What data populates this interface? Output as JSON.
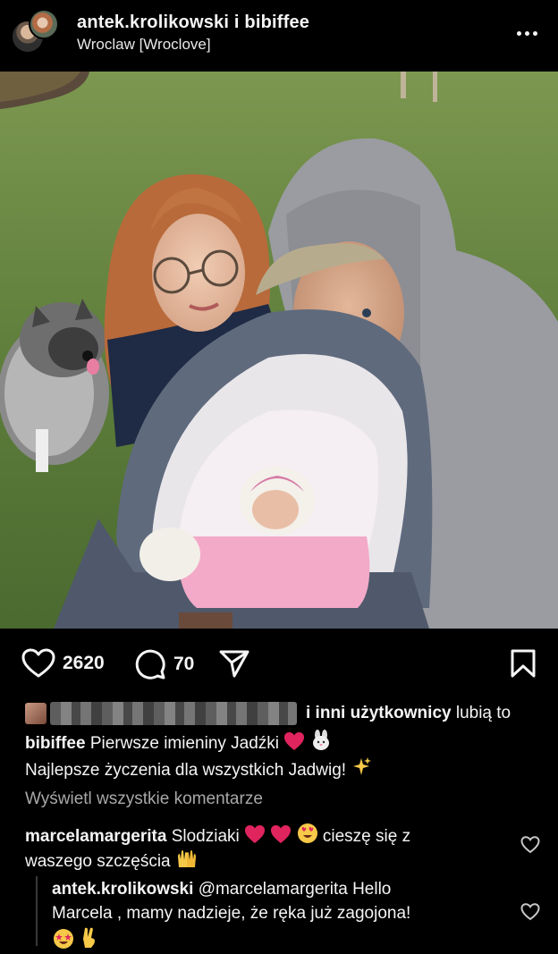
{
  "header": {
    "account_names": "antek.krolikowski i bibiffee",
    "location": "Wroclaw [Wroclove]"
  },
  "actions": {
    "like_count": "2620",
    "comment_count": "70"
  },
  "likes_line": {
    "suffix_bold": "i inni użytkownicy",
    "suffix": "lubią to"
  },
  "caption": {
    "user": "bibiffee",
    "text": "Pierwsze imieniny Jadźki",
    "line2": "Najlepsze życzenia dla wszystkich Jadwig!"
  },
  "view_all_comments": "Wyświetl wszystkie komentarze",
  "comments": [
    {
      "user": "marcelamargerita",
      "text_part1": "Slodziaki",
      "text_part2": "cieszę się z",
      "line2": "waszego szczęścia"
    }
  ],
  "replies": [
    {
      "user": "antek.krolikowski",
      "mention": "@marcelamargerita Hello",
      "line2": "Marcela , mamy nadzieje, że ręka już zagojona!"
    }
  ],
  "colors": {
    "background": "#000000",
    "text": "#f5f5f5",
    "muted": "#a8a8a8",
    "heart_emoji": "#e0245e"
  },
  "icons": [
    "more-icon",
    "heart-icon",
    "comment-icon",
    "share-icon",
    "bookmark-icon"
  ]
}
